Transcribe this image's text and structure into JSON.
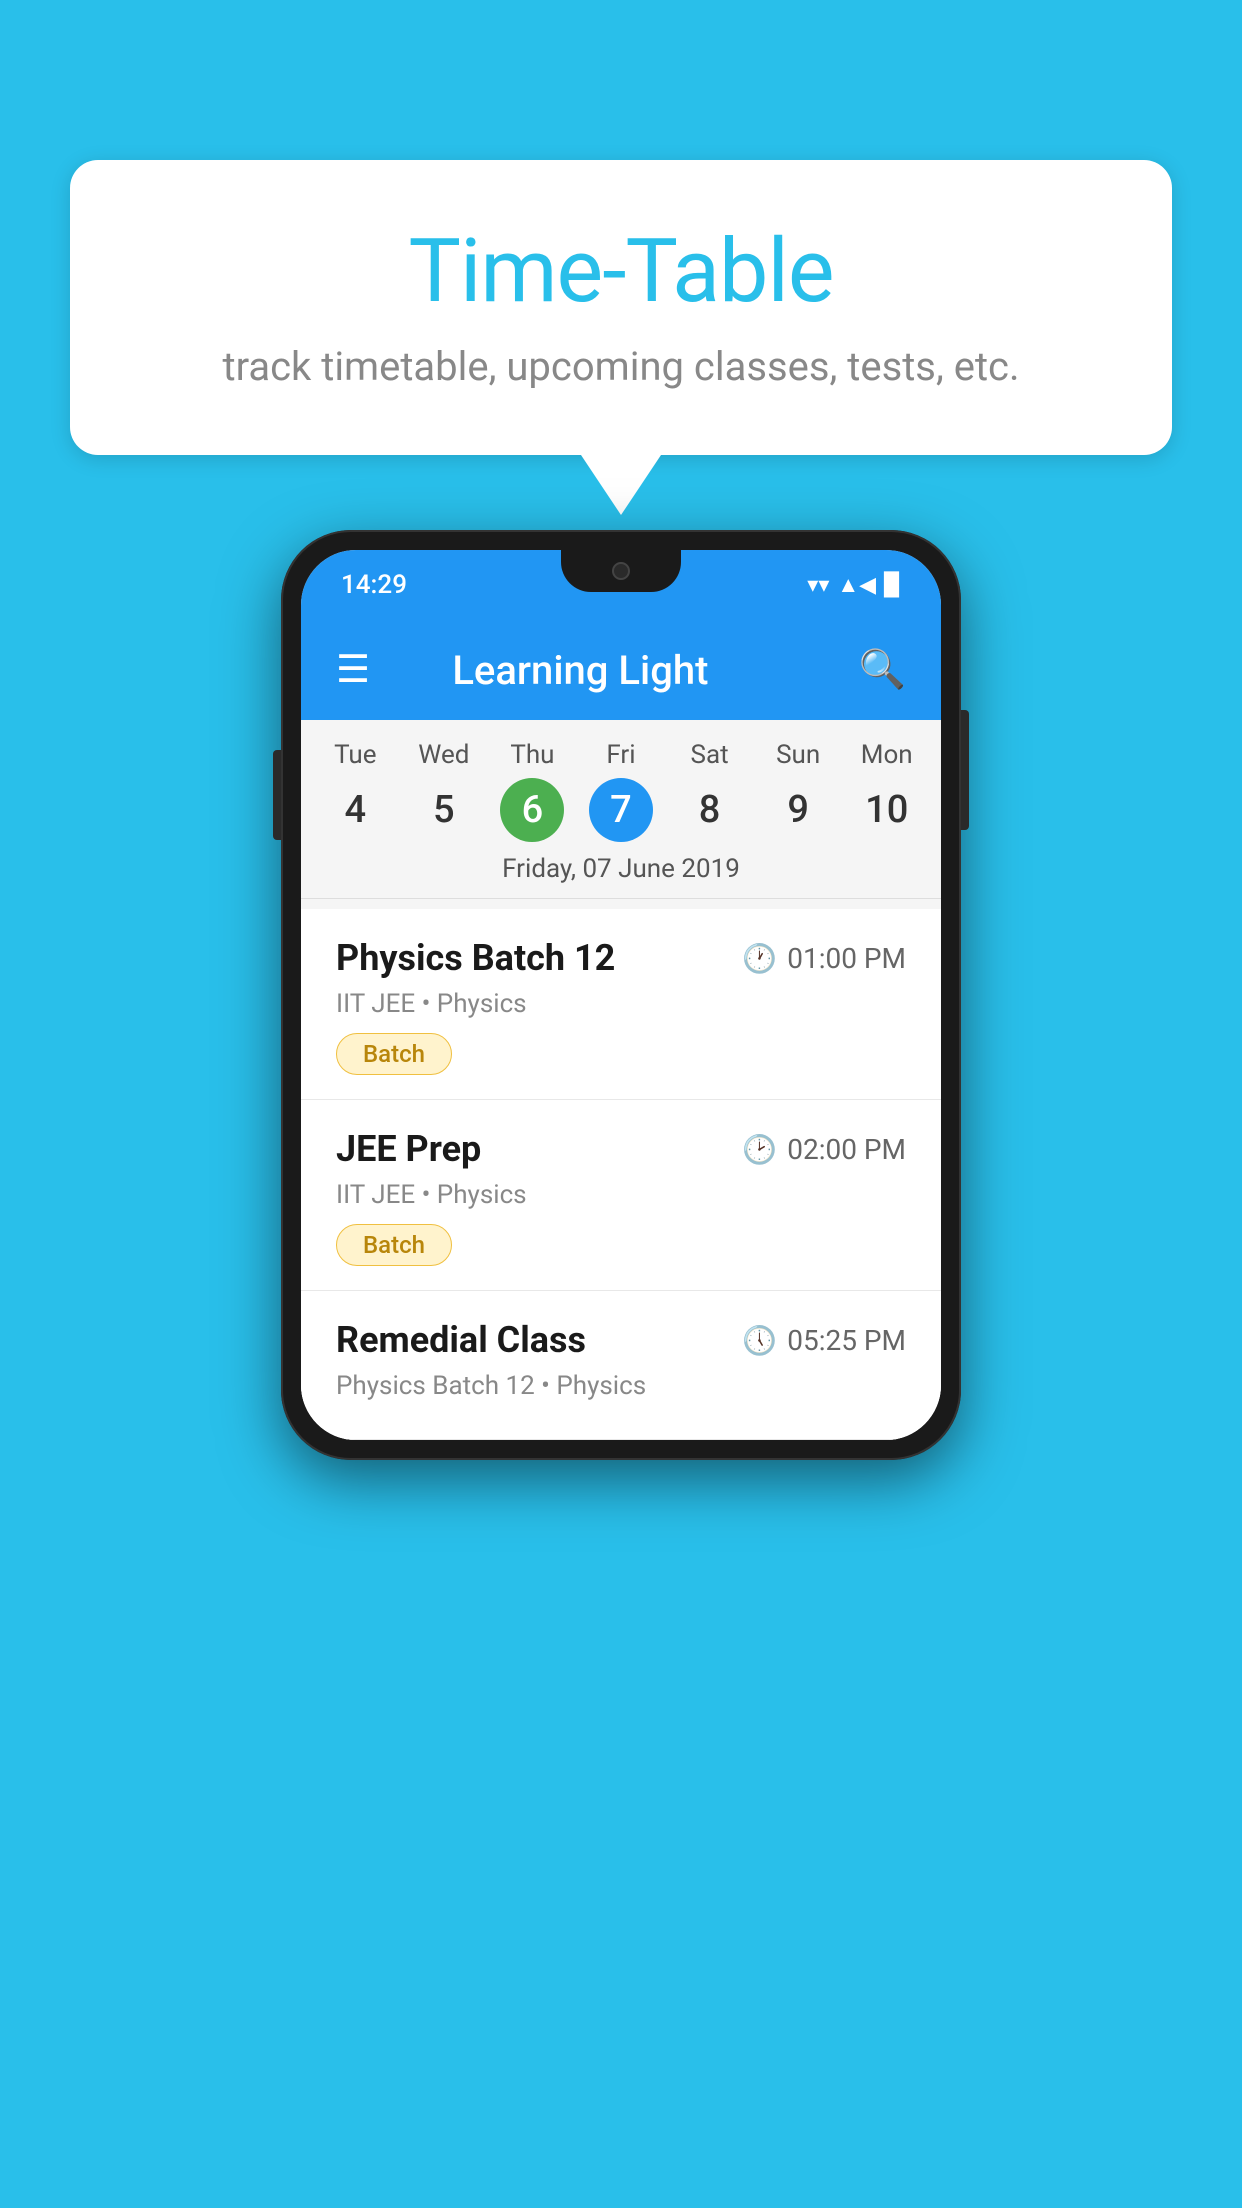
{
  "background": {
    "color": "#29BFEA"
  },
  "speech_bubble": {
    "title": "Time-Table",
    "subtitle": "track timetable, upcoming classes, tests, etc."
  },
  "phone": {
    "status_bar": {
      "time": "14:29",
      "wifi": "▼",
      "signal": "▲",
      "battery": "▉"
    },
    "app_bar": {
      "title": "Learning Light",
      "hamburger_label": "☰",
      "search_label": "🔍"
    },
    "calendar": {
      "day_headers": [
        "Tue",
        "Wed",
        "Thu",
        "Fri",
        "Sat",
        "Sun",
        "Mon"
      ],
      "day_numbers": [
        "4",
        "5",
        "6",
        "7",
        "8",
        "9",
        "10"
      ],
      "today_index": 2,
      "selected_index": 3,
      "selected_date_label": "Friday, 07 June 2019"
    },
    "schedule": [
      {
        "name": "Physics Batch 12",
        "time": "01:00 PM",
        "sub": "IIT JEE • Physics",
        "tag": "Batch"
      },
      {
        "name": "JEE Prep",
        "time": "02:00 PM",
        "sub": "IIT JEE • Physics",
        "tag": "Batch"
      },
      {
        "name": "Remedial Class",
        "time": "05:25 PM",
        "sub": "Physics Batch 12 • Physics",
        "tag": ""
      }
    ]
  }
}
